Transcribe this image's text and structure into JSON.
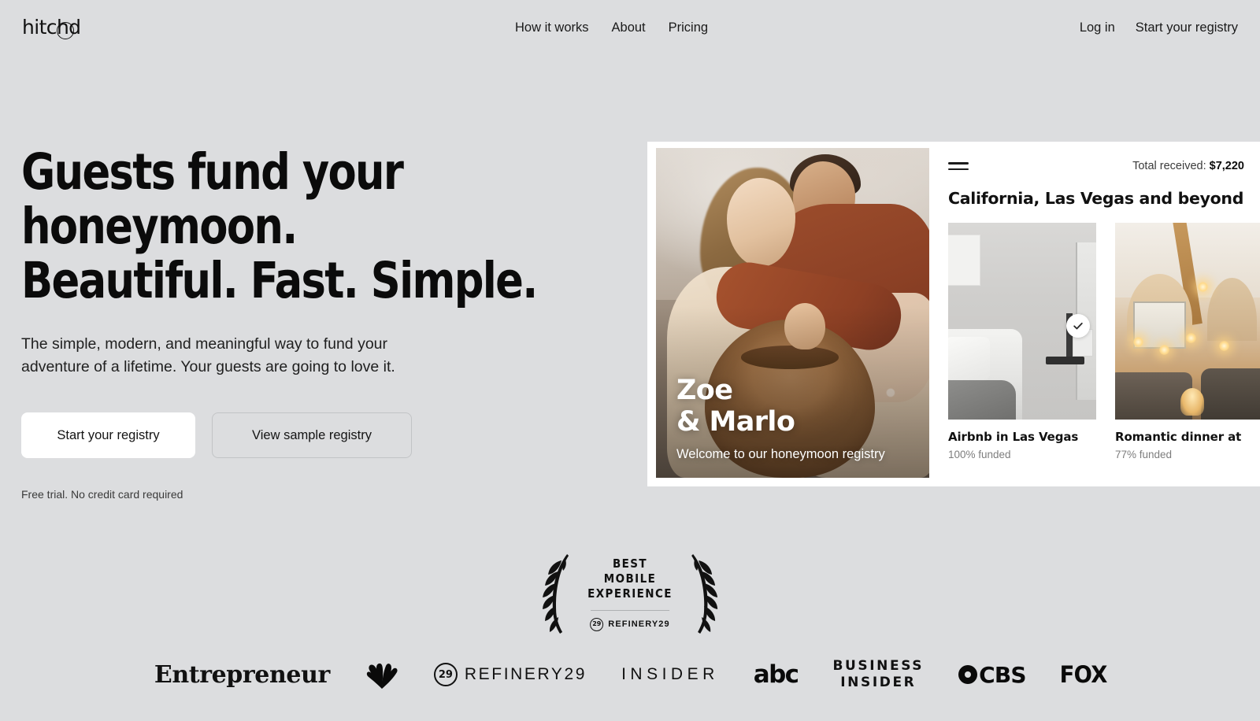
{
  "brand": {
    "logo_text": "hitchd"
  },
  "header": {
    "nav": [
      {
        "label": "How it works"
      },
      {
        "label": "About"
      },
      {
        "label": "Pricing"
      }
    ],
    "actions": [
      {
        "label": "Log in"
      },
      {
        "label": "Start your registry"
      }
    ]
  },
  "hero": {
    "headline": "Guests fund your\nhoneymoon.\nBeautiful. Fast. Simple.",
    "subhead": "The simple, modern, and meaningful way to fund your\nadventure of a lifetime. Your guests are going to love it.",
    "primary_cta": "Start your registry",
    "secondary_cta": "View sample registry",
    "fineprint": "Free trial. No credit card required"
  },
  "mock": {
    "photo": {
      "couple_name": "Zoe\n& Marlo",
      "welcome": "Welcome to our honeymoon registry"
    },
    "menu_icon": "hamburger-menu-icon",
    "total_label": "Total received:",
    "total_value": "$7,220",
    "registry_title": "California, Las Vegas and beyond",
    "gifts": [
      {
        "name": "Airbnb in Las Vegas",
        "funded": "100% funded",
        "badge": "check-icon"
      },
      {
        "name": "Romantic dinner at",
        "funded": "77% funded",
        "badge": ""
      }
    ]
  },
  "award": {
    "lines": [
      "BEST",
      "MOBILE",
      "EXPERIENCE"
    ],
    "source_mark": "29",
    "source": "REFINERY29"
  },
  "press": {
    "logos": [
      {
        "name": "Entrepreneur",
        "text": "Entrepreneur"
      },
      {
        "name": "NBC",
        "text": ""
      },
      {
        "name": "Refinery29",
        "text": "REFINERY29",
        "mark": "29"
      },
      {
        "name": "Insider",
        "text": "INSIDER"
      },
      {
        "name": "abc",
        "text": "abc"
      },
      {
        "name": "Business Insider",
        "text": "BUSINESS\nINSIDER"
      },
      {
        "name": "CBS",
        "text": "CBS"
      },
      {
        "name": "FOX",
        "text": "FOX"
      }
    ]
  },
  "colors": {
    "background": "#dcdddf",
    "panel": "#ffffff",
    "text": "#111111",
    "muted": "#7d7d7d"
  }
}
